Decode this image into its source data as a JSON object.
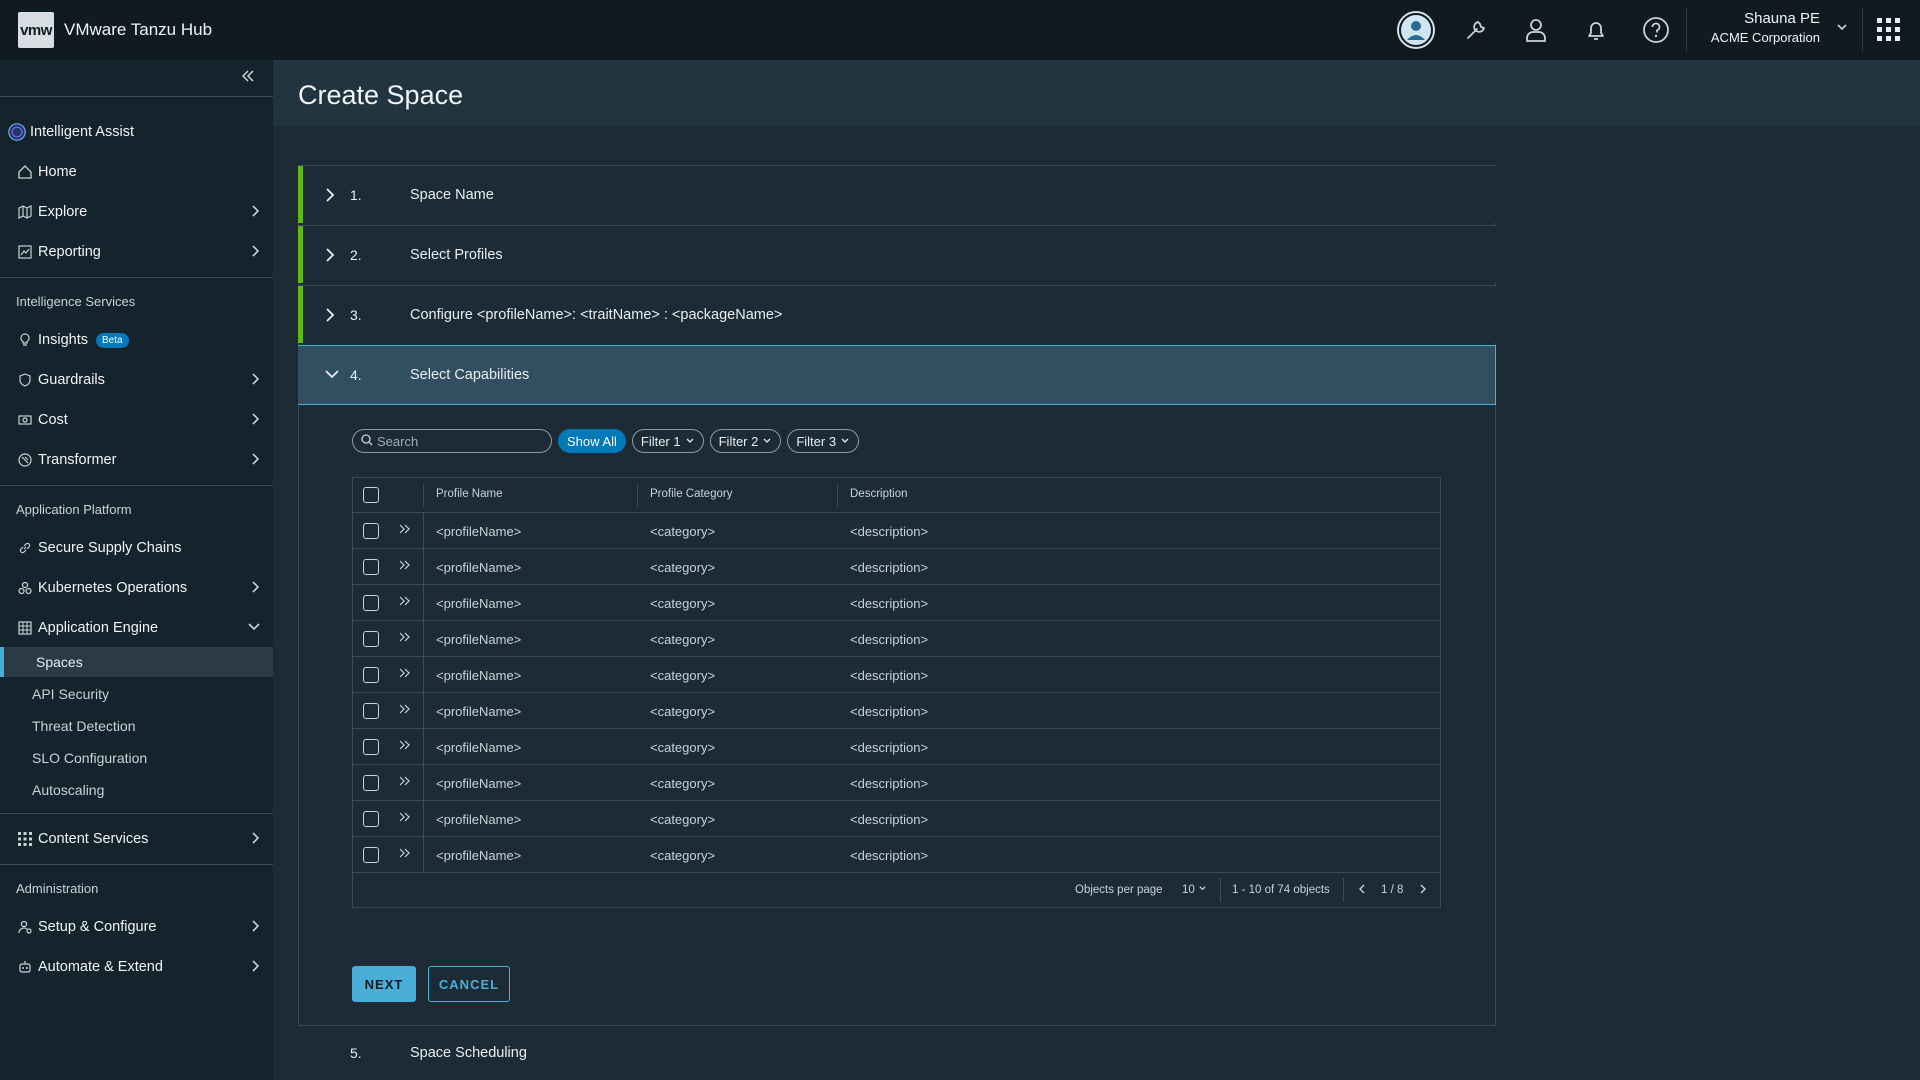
{
  "header": {
    "logo_text": "vmw",
    "app_title": "VMware Tanzu Hub",
    "user_name": "Shauna PE",
    "org_name": "ACME Corporation"
  },
  "sidebar": {
    "intelligent_assist": "Intelligent Assist",
    "home": "Home",
    "explore": "Explore",
    "reporting": "Reporting",
    "section_intelligence": "Intelligence Services",
    "insights": "Insights",
    "insights_badge": "Beta",
    "guardrails": "Guardrails",
    "cost": "Cost",
    "transformer": "Transformer",
    "section_app_platform": "Application Platform",
    "secure_supply_chains": "Secure Supply Chains",
    "kubernetes_operations": "Kubernetes Operations",
    "application_engine": "Application Engine",
    "sub_items": [
      "Spaces",
      "API Security",
      "Threat Detection",
      "SLO Configuration",
      "Autoscaling"
    ],
    "content_services": "Content Services",
    "section_admin": "Administration",
    "setup_configure": "Setup & Configure",
    "automate_extend": "Automate & Extend"
  },
  "page": {
    "title": "Create Space"
  },
  "steps": [
    {
      "num": "1.",
      "label": "Space Name"
    },
    {
      "num": "2.",
      "label": "Select Profiles"
    },
    {
      "num": "3.",
      "label": "Configure <profileName>: <traitName> : <packageName>"
    },
    {
      "num": "4.",
      "label": "Select Capabilities"
    },
    {
      "num": "5.",
      "label": "Space Scheduling"
    }
  ],
  "toolbar": {
    "search_placeholder": "Search",
    "show_all": "Show All",
    "filter1": "Filter 1",
    "filter2": "Filter 2",
    "filter3": "Filter 3"
  },
  "table": {
    "headers": [
      "Profile Name",
      "Profile Category",
      "Description"
    ],
    "rows": [
      [
        "<profileName>",
        "<category>",
        "<description>"
      ],
      [
        "<profileName>",
        "<category>",
        "<description>"
      ],
      [
        "<profileName>",
        "<category>",
        "<description>"
      ],
      [
        "<profileName>",
        "<category>",
        "<description>"
      ],
      [
        "<profileName>",
        "<category>",
        "<description>"
      ],
      [
        "<profileName>",
        "<category>",
        "<description>"
      ],
      [
        "<profileName>",
        "<category>",
        "<description>"
      ],
      [
        "<profileName>",
        "<category>",
        "<description>"
      ],
      [
        "<profileName>",
        "<category>",
        "<description>"
      ],
      [
        "<profileName>",
        "<category>",
        "<description>"
      ]
    ],
    "footer": {
      "objects_per_page_label": "Objects  per page",
      "per_page_value": "10",
      "range_text": "1 - 10 of 74 objects",
      "page_text": "1 / 8"
    }
  },
  "buttons": {
    "next": "NEXT",
    "cancel": "CANCEL"
  },
  "colors": {
    "accent": "#49afd9",
    "step_complete": "#61b715",
    "primary": "#0079b8"
  }
}
